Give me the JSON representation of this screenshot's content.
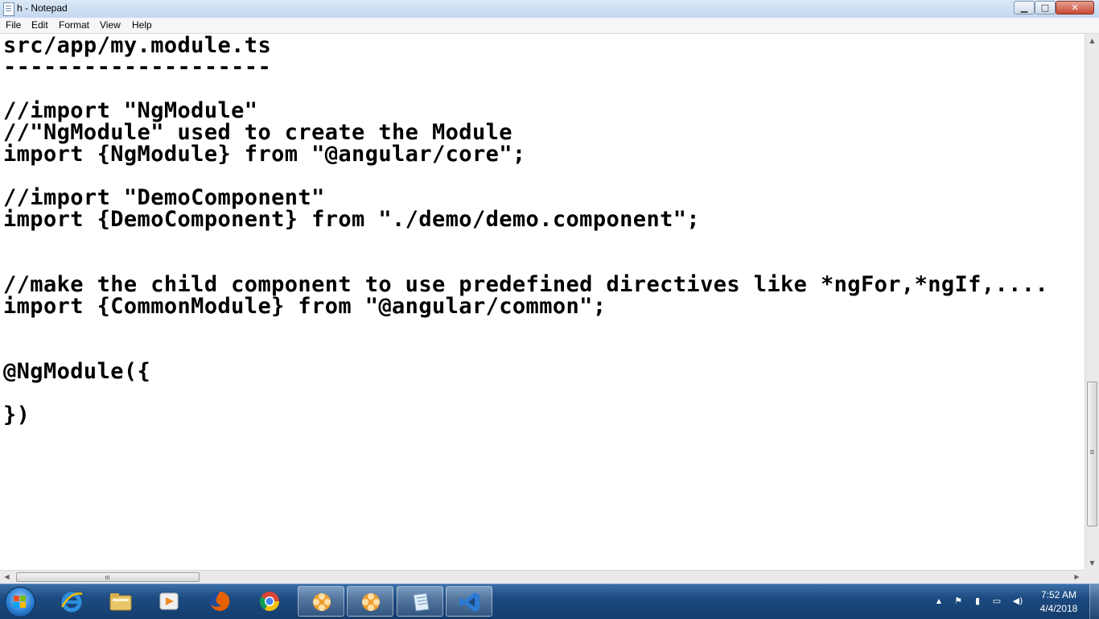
{
  "window": {
    "title": "h - Notepad",
    "controls": {
      "minimize": "▁",
      "maximize": "□",
      "close": "✕"
    }
  },
  "menu": {
    "items": [
      "File",
      "Edit",
      "Format",
      "View",
      "Help"
    ]
  },
  "editor": {
    "lines": [
      "src/app/my.module.ts",
      "--------------------",
      "//import \"NgModule\"",
      "//\"NgModule\" used to create the Module",
      "import {NgModule} from \"@angular/core\";",
      "//import \"DemoComponent\"",
      "import {DemoComponent} from \"./demo/demo.component\";",
      "//make the child component to use predefined directives like *ngFor,*ngIf,....",
      "import {CommonModule} from \"@angular/common\";",
      "@NgModule({",
      "})"
    ]
  },
  "scrollbars": {
    "up_arrow": "▲",
    "down_arrow": "▼",
    "left_arrow": "◀",
    "right_arrow": "▶"
  },
  "taskbar": {
    "pinned_apps": [
      {
        "name": "internet-explorer-icon",
        "color": "#2f8fe0"
      },
      {
        "name": "file-explorer-icon",
        "color": "#e8c46a"
      },
      {
        "name": "media-player-icon",
        "color": "#f08a24"
      },
      {
        "name": "firefox-icon",
        "color": "#e66000"
      },
      {
        "name": "chrome-icon",
        "color": "#4caf50"
      },
      {
        "name": "app-flower-icon",
        "color": "#f0a030"
      },
      {
        "name": "app-flower-icon-2",
        "color": "#f0a030"
      },
      {
        "name": "notepad-icon",
        "color": "#9cc6e6"
      },
      {
        "name": "vscode-icon",
        "color": "#2b7bd4"
      }
    ],
    "tray": {
      "show_hidden": "▲",
      "flag": "⚑",
      "power": "▮",
      "network": "▭",
      "volume": "◀)"
    },
    "clock": {
      "time": "7:52 AM",
      "date": "4/4/2018"
    }
  }
}
